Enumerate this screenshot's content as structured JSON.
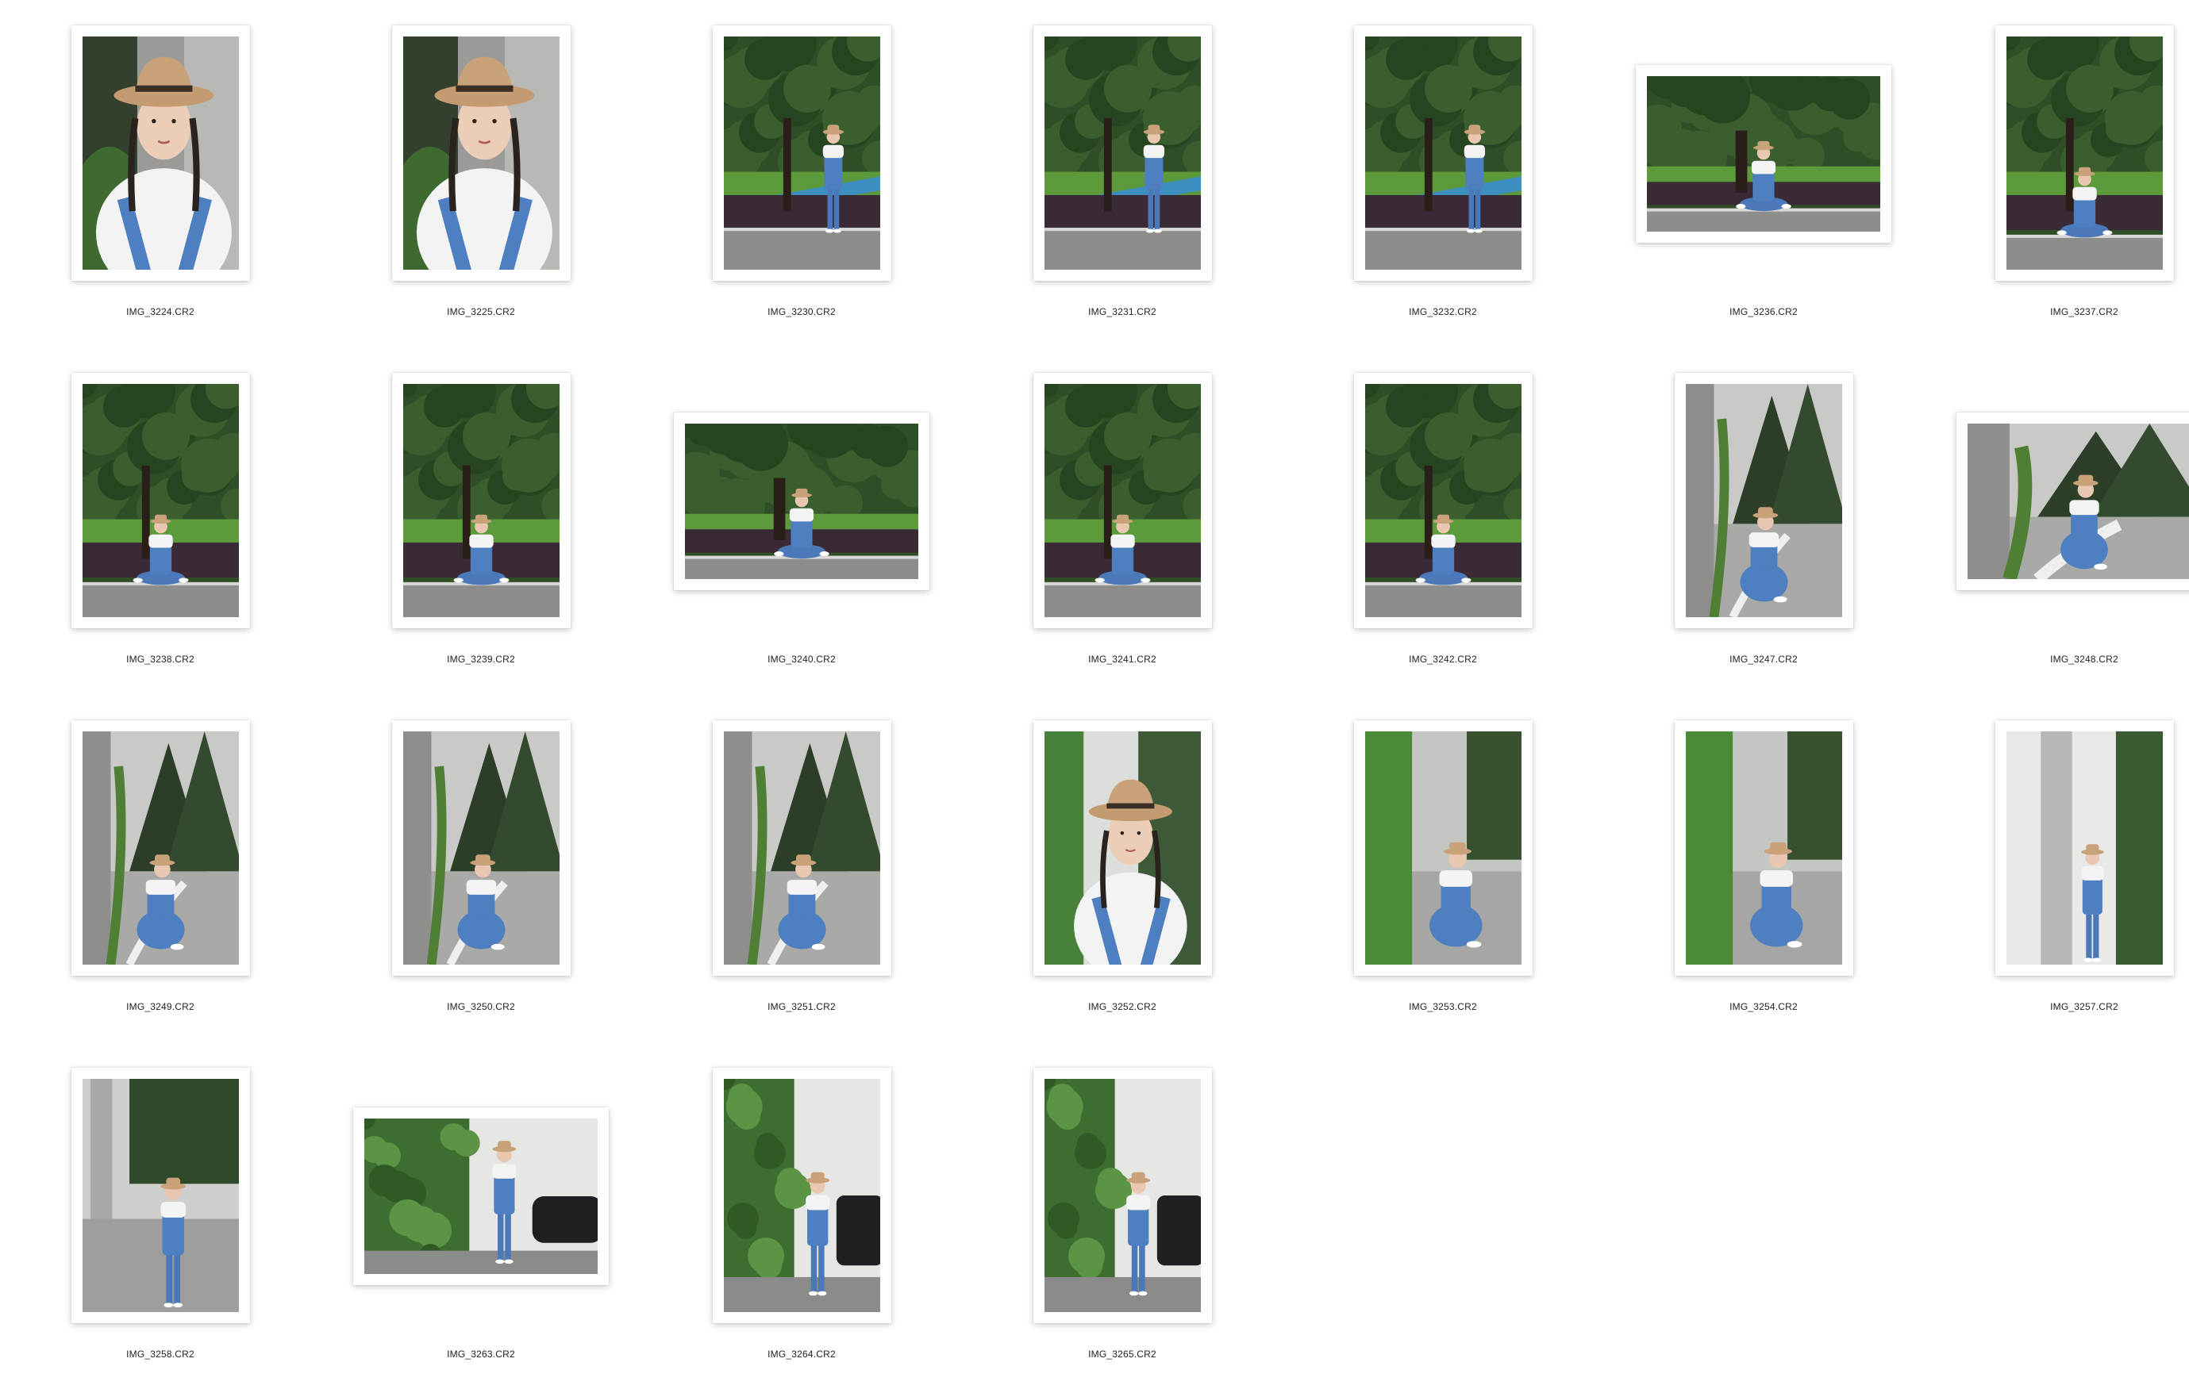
{
  "files": [
    {
      "name": "IMG_3224.CR2",
      "orientation": "portrait",
      "scene": "closeup"
    },
    {
      "name": "IMG_3225.CR2",
      "orientation": "portrait",
      "scene": "closeup"
    },
    {
      "name": "IMG_3230.CR2",
      "orientation": "portrait",
      "scene": "tree-standing"
    },
    {
      "name": "IMG_3231.CR2",
      "orientation": "portrait",
      "scene": "tree-standing"
    },
    {
      "name": "IMG_3232.CR2",
      "orientation": "portrait",
      "scene": "tree-standing"
    },
    {
      "name": "IMG_3236.CR2",
      "orientation": "landscape",
      "scene": "tree-sitting"
    },
    {
      "name": "IMG_3237.CR2",
      "orientation": "portrait",
      "scene": "tree-sitting"
    },
    {
      "name": "IMG_3238.CR2",
      "orientation": "portrait",
      "scene": "tree-sitting"
    },
    {
      "name": "IMG_3239.CR2",
      "orientation": "portrait",
      "scene": "tree-sitting"
    },
    {
      "name": "IMG_3240.CR2",
      "orientation": "landscape",
      "scene": "tree-sitting"
    },
    {
      "name": "IMG_3241.CR2",
      "orientation": "portrait",
      "scene": "tree-sitting"
    },
    {
      "name": "IMG_3242.CR2",
      "orientation": "portrait",
      "scene": "tree-sitting"
    },
    {
      "name": "IMG_3247.CR2",
      "orientation": "portrait",
      "scene": "pillar-crouch"
    },
    {
      "name": "IMG_3248.CR2",
      "orientation": "landscape",
      "scene": "pillar-crouch"
    },
    {
      "name": "IMG_3249.CR2",
      "orientation": "portrait",
      "scene": "pillar-crouch"
    },
    {
      "name": "IMG_3250.CR2",
      "orientation": "portrait",
      "scene": "pillar-crouch"
    },
    {
      "name": "IMG_3251.CR2",
      "orientation": "portrait",
      "scene": "pillar-crouch"
    },
    {
      "name": "IMG_3252.CR2",
      "orientation": "portrait",
      "scene": "plants-closeup"
    },
    {
      "name": "IMG_3253.CR2",
      "orientation": "portrait",
      "scene": "plants-crouch"
    },
    {
      "name": "IMG_3254.CR2",
      "orientation": "portrait",
      "scene": "plants-crouch"
    },
    {
      "name": "IMG_3257.CR2",
      "orientation": "portrait",
      "scene": "wall-standing"
    },
    {
      "name": "IMG_3258.CR2",
      "orientation": "portrait",
      "scene": "pole-standing"
    },
    {
      "name": "IMG_3263.CR2",
      "orientation": "landscape",
      "scene": "vines-car"
    },
    {
      "name": "IMG_3264.CR2",
      "orientation": "portrait",
      "scene": "vines-car"
    },
    {
      "name": "IMG_3265.CR2",
      "orientation": "portrait",
      "scene": "vines-car"
    }
  ]
}
